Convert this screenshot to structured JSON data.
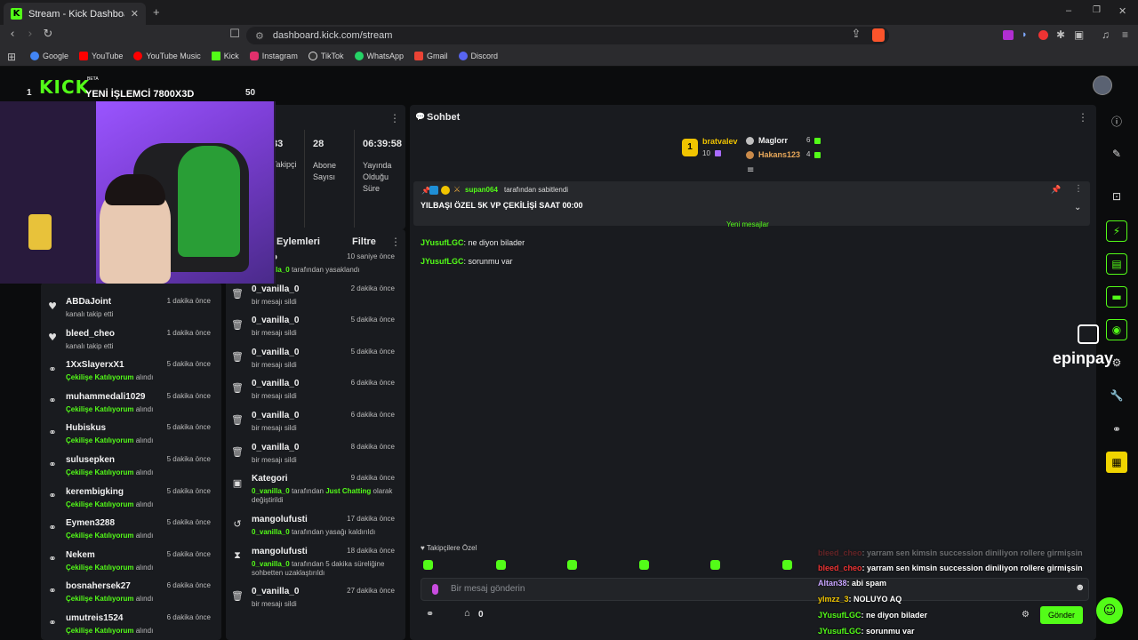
{
  "browser": {
    "tab_title": "Stream - Kick Dashboard",
    "url": "dashboard.kick.com/stream",
    "bookmarks": [
      {
        "label": "Google",
        "color": "#4285f4"
      },
      {
        "label": "YouTube",
        "color": "#ff0000"
      },
      {
        "label": "YouTube Music",
        "color": "#ff0000"
      },
      {
        "label": "Kick",
        "color": "#53fc18"
      },
      {
        "label": "Instagram",
        "color": "#e1306c"
      },
      {
        "label": "TikTok",
        "color": "#ffffff"
      },
      {
        "label": "WhatsApp",
        "color": "#25d366"
      },
      {
        "label": "Gmail",
        "color": "#ea4335"
      },
      {
        "label": "Discord",
        "color": "#5865f2"
      }
    ]
  },
  "webcam": {
    "logo": "KICK",
    "logo_badge": "BETA",
    "left_number": "1",
    "title": "YENİ İŞLEMCİ 7800X3D",
    "right_number": "50"
  },
  "stats": {
    "items": [
      {
        "value": "33",
        "label": "Takipçi"
      },
      {
        "value": "28",
        "label": "Abone Sayısı"
      },
      {
        "value": "06:39:58",
        "label": "Yayında Olduğu Süre"
      }
    ]
  },
  "activity": {
    "items": [
      {
        "icon": "heart",
        "name": "ABDaJoint",
        "text": "kanalı takip etti",
        "time": "1 dakika önce"
      },
      {
        "icon": "heart",
        "name": "bleed_cheo",
        "text": "kanalı takip etti",
        "time": "1 dakika önce"
      },
      {
        "icon": "points",
        "name": "1XxSlayerxX1",
        "highlight": "Çekilişe Katılıyorum",
        "text": "alındı",
        "time": "5 dakika önce"
      },
      {
        "icon": "points",
        "name": "muhammedali1029",
        "highlight": "Çekilişe Katılıyorum",
        "text": "alındı",
        "time": "5 dakika önce"
      },
      {
        "icon": "points",
        "name": "Hubiskus",
        "highlight": "Çekilişe Katılıyorum",
        "text": "alındı",
        "time": "5 dakika önce"
      },
      {
        "icon": "points",
        "name": "sulusepken",
        "highlight": "Çekilişe Katılıyorum",
        "text": "alındı",
        "time": "5 dakika önce"
      },
      {
        "icon": "points",
        "name": "kerembigking",
        "highlight": "Çekilişe Katılıyorum",
        "text": "alındı",
        "time": "5 dakika önce"
      },
      {
        "icon": "points",
        "name": "Eymen3288",
        "highlight": "Çekilişe Katılıyorum",
        "text": "alındı",
        "time": "5 dakika önce"
      },
      {
        "icon": "points",
        "name": "Nekem",
        "highlight": "Çekilişe Katılıyorum",
        "text": "alındı",
        "time": "5 dakika önce"
      },
      {
        "icon": "points",
        "name": "bosnahersek27",
        "highlight": "Çekilişe Katılıyorum",
        "text": "alındı",
        "time": "6 dakika önce"
      },
      {
        "icon": "points",
        "name": "umutreis1524",
        "highlight": "Çekilişe Katılıyorum",
        "text": "alındı",
        "time": "6 dakika önce"
      }
    ]
  },
  "modlog": {
    "title": "Eylemleri",
    "filter_label": "Filtre",
    "items": [
      {
        "icon": "ban",
        "name": "_cheo",
        "highlight": "0_vanilla_0",
        "text": "tarafından yasaklandı",
        "time": "10 saniye önce"
      },
      {
        "icon": "trash",
        "name": "0_vanilla_0",
        "text": "bir mesajı sildi",
        "time": "2 dakika önce"
      },
      {
        "icon": "trash",
        "name": "0_vanilla_0",
        "text": "bir mesajı sildi",
        "time": "5 dakika önce"
      },
      {
        "icon": "trash",
        "name": "0_vanilla_0",
        "text": "bir mesajı sildi",
        "time": "5 dakika önce"
      },
      {
        "icon": "trash",
        "name": "0_vanilla_0",
        "text": "bir mesajı sildi",
        "time": "6 dakika önce"
      },
      {
        "icon": "trash",
        "name": "0_vanilla_0",
        "text": "bir mesajı sildi",
        "time": "6 dakika önce"
      },
      {
        "icon": "trash",
        "name": "0_vanilla_0",
        "text": "bir mesajı sildi",
        "time": "8 dakika önce"
      },
      {
        "icon": "category",
        "name": "Kategori",
        "highlight": "0_vanilla_0",
        "text": "tarafından",
        "highlight2": "Just Chatting",
        "text2": "olarak değiştirildi",
        "time": "9 dakika önce"
      },
      {
        "icon": "undo",
        "name": "mangolufusti",
        "highlight": "0_vanilla_0",
        "text": "tarafından yasağı kaldırıldı",
        "time": "17 dakika önce"
      },
      {
        "icon": "timeout",
        "name": "mangolufusti",
        "highlight": "0_vanilla_0",
        "text": "tarafından 5 dakika süreliğine sohbetten uzaklaştırıldı",
        "time": "18 dakika önce"
      },
      {
        "icon": "trash",
        "name": "0_vanilla_0",
        "text": "bir mesajı sildi",
        "time": "27 dakika önce"
      }
    ]
  },
  "chat": {
    "title": "Sohbet",
    "leaderboard": [
      {
        "rank": "1",
        "name": "bratvalev",
        "count": "10"
      },
      {
        "name": "Maglorr",
        "count": "6"
      },
      {
        "name": "Hakans123",
        "count": "4"
      }
    ],
    "pinned": {
      "by": "supan064",
      "by_suffix": "tarafından sabitlendi",
      "message": "YILBAŞI ÖZEL 5K VP ÇEKİLİŞİ SAAT 00:00"
    },
    "new_messages_label": "Yeni mesajlar",
    "messages": [
      {
        "user": "JYusufLGC",
        "text": "ne diyon bilader"
      },
      {
        "user": "JYusufLGC",
        "text": "sorunmu var"
      }
    ],
    "followers_only_label": "Takipçilere Özel",
    "input_placeholder": "Bir mesaj gönderin",
    "points_value": "0",
    "send_label": "Gönder"
  },
  "overlay": {
    "brand": "epinpay",
    "messages": [
      {
        "user": "bleed_cheo",
        "text": "yarram sen kimsin succession diniliyon rollere girmişsin"
      },
      {
        "user": "bleed_cheo",
        "text": "yarram sen kimsin succession diniliyon rollere girmişsin"
      },
      {
        "user": "Altan38",
        "text": "abi spam"
      },
      {
        "user": "ylmzz_3",
        "text": "NOLUYO AQ"
      },
      {
        "user": "JYusufLGC",
        "text": "ne diyon bilader"
      },
      {
        "user": "JYusufLGC",
        "text": "sorunmu var"
      }
    ]
  },
  "colors": {
    "accent": "#53fc18",
    "panel": "#191b1f",
    "background": "#0b0c0d"
  }
}
